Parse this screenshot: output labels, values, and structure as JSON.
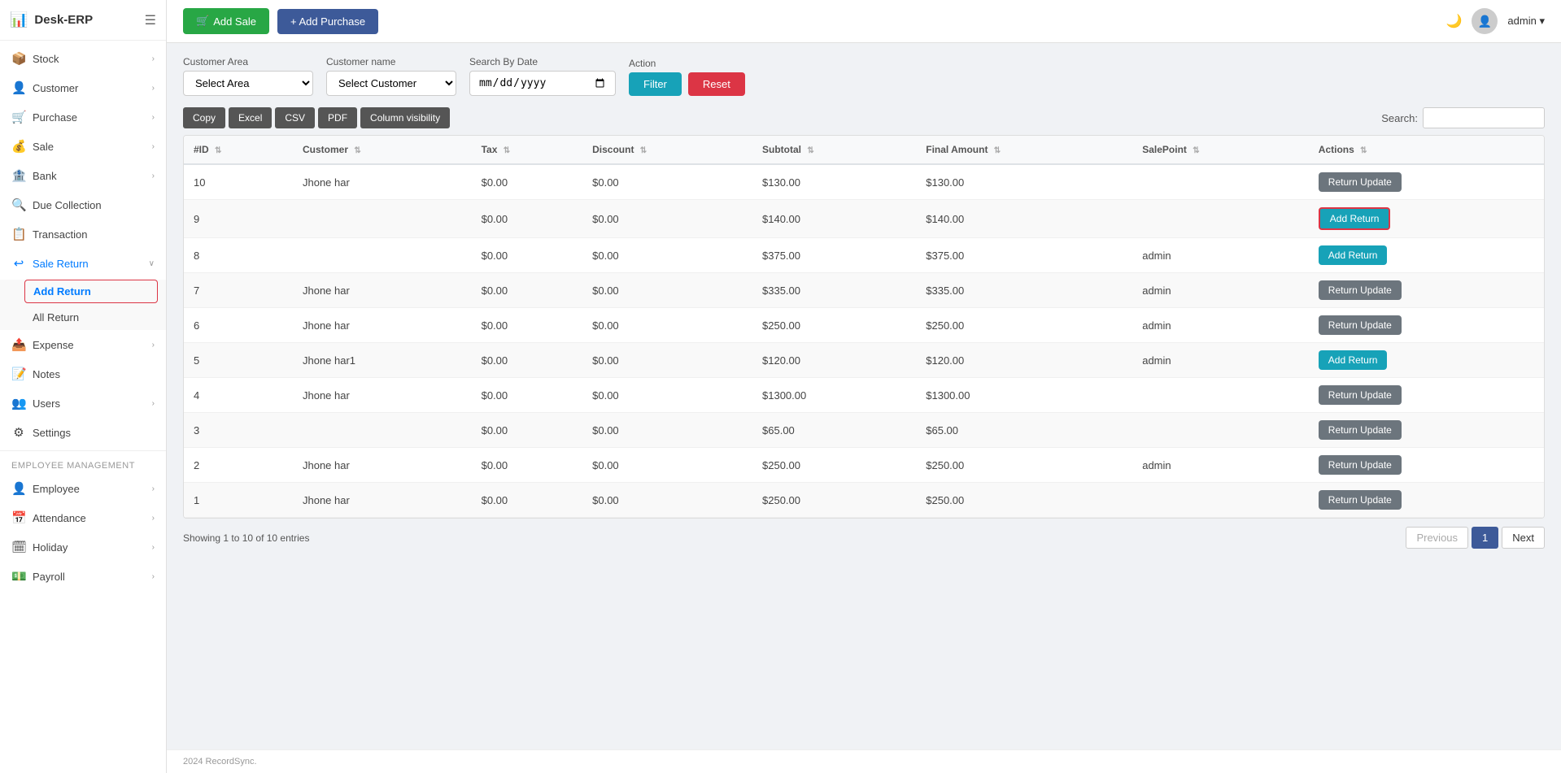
{
  "app": {
    "name": "Desk-ERP",
    "logo_symbol": "📊"
  },
  "topbar": {
    "add_sale_label": "Add Sale",
    "add_purchase_label": "+ Add Purchase",
    "user_name": "admin",
    "user_dropdown_icon": "▾"
  },
  "sidebar": {
    "items": [
      {
        "id": "stock",
        "label": "Stock",
        "icon": "📦",
        "has_arrow": true
      },
      {
        "id": "customer",
        "label": "Customer",
        "icon": "👤",
        "has_arrow": true
      },
      {
        "id": "purchase",
        "label": "Purchase",
        "icon": "🛒",
        "has_arrow": true
      },
      {
        "id": "sale",
        "label": "Sale",
        "icon": "💰",
        "has_arrow": true
      },
      {
        "id": "bank",
        "label": "Bank",
        "icon": "🏦",
        "has_arrow": true
      },
      {
        "id": "due-collection",
        "label": "Due Collection",
        "icon": "🔍",
        "has_arrow": false
      },
      {
        "id": "transaction",
        "label": "Transaction",
        "icon": "📋",
        "has_arrow": false
      },
      {
        "id": "sale-return",
        "label": "Sale Return",
        "icon": "↩",
        "has_arrow": true,
        "active": true
      },
      {
        "id": "expense",
        "label": "Expense",
        "icon": "📤",
        "has_arrow": true
      },
      {
        "id": "notes",
        "label": "Notes",
        "icon": "📝",
        "has_arrow": false
      },
      {
        "id": "users",
        "label": "Users",
        "icon": "👥",
        "has_arrow": true
      },
      {
        "id": "settings",
        "label": "Settings",
        "icon": "⚙",
        "has_arrow": false
      }
    ],
    "sale_return_sub": [
      {
        "id": "add-return",
        "label": "Add Return",
        "active": true
      },
      {
        "id": "all-return",
        "label": "All Return",
        "active": false
      }
    ],
    "employee_section_title": "Employee Management",
    "employee_items": [
      {
        "id": "employee",
        "label": "Employee",
        "icon": "👤",
        "has_arrow": true
      },
      {
        "id": "attendance",
        "label": "Attendance",
        "icon": "📅",
        "has_arrow": true
      },
      {
        "id": "holiday",
        "label": "Holiday",
        "icon": "🗓",
        "has_arrow": true
      },
      {
        "id": "payroll",
        "label": "Payroll",
        "icon": "💵",
        "has_arrow": true
      }
    ]
  },
  "filters": {
    "customer_area_label": "Customer Area",
    "customer_area_placeholder": "Select Area",
    "customer_name_label": "Customer name",
    "customer_name_placeholder": "Select Customer",
    "date_label": "Search By Date",
    "date_placeholder": "mm/dd/yyyy",
    "action_label": "Action",
    "filter_btn": "Filter",
    "reset_btn": "Reset"
  },
  "table_controls": {
    "buttons": [
      "Copy",
      "Excel",
      "CSV",
      "PDF",
      "Column visibility"
    ],
    "search_label": "Search:"
  },
  "table": {
    "columns": [
      "#ID",
      "Customer",
      "Tax",
      "Discount",
      "Subtotal",
      "Final Amount",
      "SalePoint",
      "Actions"
    ],
    "rows": [
      {
        "id": "10",
        "customer": "Jhone har",
        "tax": "$0.00",
        "discount": "$0.00",
        "subtotal": "$130.00",
        "final_amount": "$130.00",
        "salepoint": "",
        "action": "Return Update",
        "action_type": "update"
      },
      {
        "id": "9",
        "customer": "",
        "tax": "$0.00",
        "discount": "$0.00",
        "subtotal": "$140.00",
        "final_amount": "$140.00",
        "salepoint": "",
        "action": "Add Return",
        "action_type": "add",
        "highlighted": true
      },
      {
        "id": "8",
        "customer": "",
        "tax": "$0.00",
        "discount": "$0.00",
        "subtotal": "$375.00",
        "final_amount": "$375.00",
        "salepoint": "admin",
        "action": "Add Return",
        "action_type": "add"
      },
      {
        "id": "7",
        "customer": "Jhone har",
        "tax": "$0.00",
        "discount": "$0.00",
        "subtotal": "$335.00",
        "final_amount": "$335.00",
        "salepoint": "admin",
        "action": "Return Update",
        "action_type": "update"
      },
      {
        "id": "6",
        "customer": "Jhone har",
        "tax": "$0.00",
        "discount": "$0.00",
        "subtotal": "$250.00",
        "final_amount": "$250.00",
        "salepoint": "admin",
        "action": "Return Update",
        "action_type": "update"
      },
      {
        "id": "5",
        "customer": "Jhone har1",
        "tax": "$0.00",
        "discount": "$0.00",
        "subtotal": "$120.00",
        "final_amount": "$120.00",
        "salepoint": "admin",
        "action": "Add Return",
        "action_type": "add"
      },
      {
        "id": "4",
        "customer": "Jhone har",
        "tax": "$0.00",
        "discount": "$0.00",
        "subtotal": "$1300.00",
        "final_amount": "$1300.00",
        "salepoint": "",
        "action": "Return Update",
        "action_type": "update"
      },
      {
        "id": "3",
        "customer": "",
        "tax": "$0.00",
        "discount": "$0.00",
        "subtotal": "$65.00",
        "final_amount": "$65.00",
        "salepoint": "",
        "action": "Return Update",
        "action_type": "update"
      },
      {
        "id": "2",
        "customer": "Jhone har",
        "tax": "$0.00",
        "discount": "$0.00",
        "subtotal": "$250.00",
        "final_amount": "$250.00",
        "salepoint": "admin",
        "action": "Return Update",
        "action_type": "update"
      },
      {
        "id": "1",
        "customer": "Jhone har",
        "tax": "$0.00",
        "discount": "$0.00",
        "subtotal": "$250.00",
        "final_amount": "$250.00",
        "salepoint": "",
        "action": "Return Update",
        "action_type": "update"
      }
    ]
  },
  "pagination": {
    "showing_text": "Showing 1 to 10 of 10 entries",
    "previous_label": "Previous",
    "next_label": "Next",
    "current_page": "1"
  },
  "footer": {
    "text": "2024 RecordSync."
  }
}
